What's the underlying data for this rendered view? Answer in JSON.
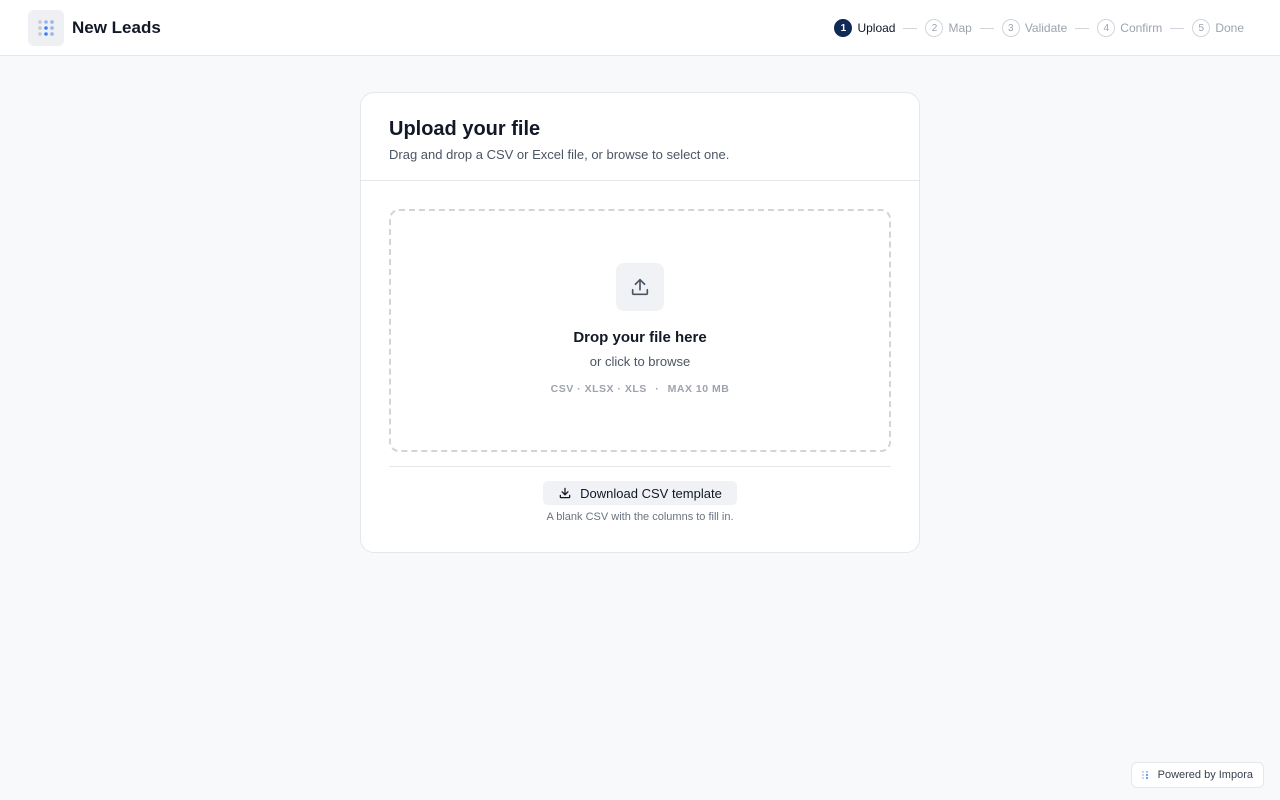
{
  "header": {
    "title": "New Leads",
    "logo_icon": "dot-grid-icon"
  },
  "stepper": {
    "active_step": 1,
    "steps": [
      {
        "num": "1",
        "label": "Upload"
      },
      {
        "num": "2",
        "label": "Map"
      },
      {
        "num": "3",
        "label": "Validate"
      },
      {
        "num": "4",
        "label": "Confirm"
      },
      {
        "num": "5",
        "label": "Done"
      }
    ]
  },
  "card": {
    "title": "Upload your file",
    "subtitle": "Drag and drop a CSV or Excel file, or browse to select one."
  },
  "dropzone": {
    "icon": "upload-icon",
    "title": "Drop your file here",
    "subtitle": "or click to browse",
    "formats": "CSV · XLSX · XLS",
    "separator": "·",
    "max_size": "MAX 10 MB"
  },
  "template": {
    "button_label": "Download CSV template",
    "button_icon": "download-icon",
    "hint": "A blank CSV with the columns to fill in."
  },
  "footer": {
    "powered_by": "Powered by Impora"
  },
  "colors": {
    "accent": "#0f2a55",
    "background": "#f8f9fb",
    "logo_dots": "#3b82f6"
  }
}
